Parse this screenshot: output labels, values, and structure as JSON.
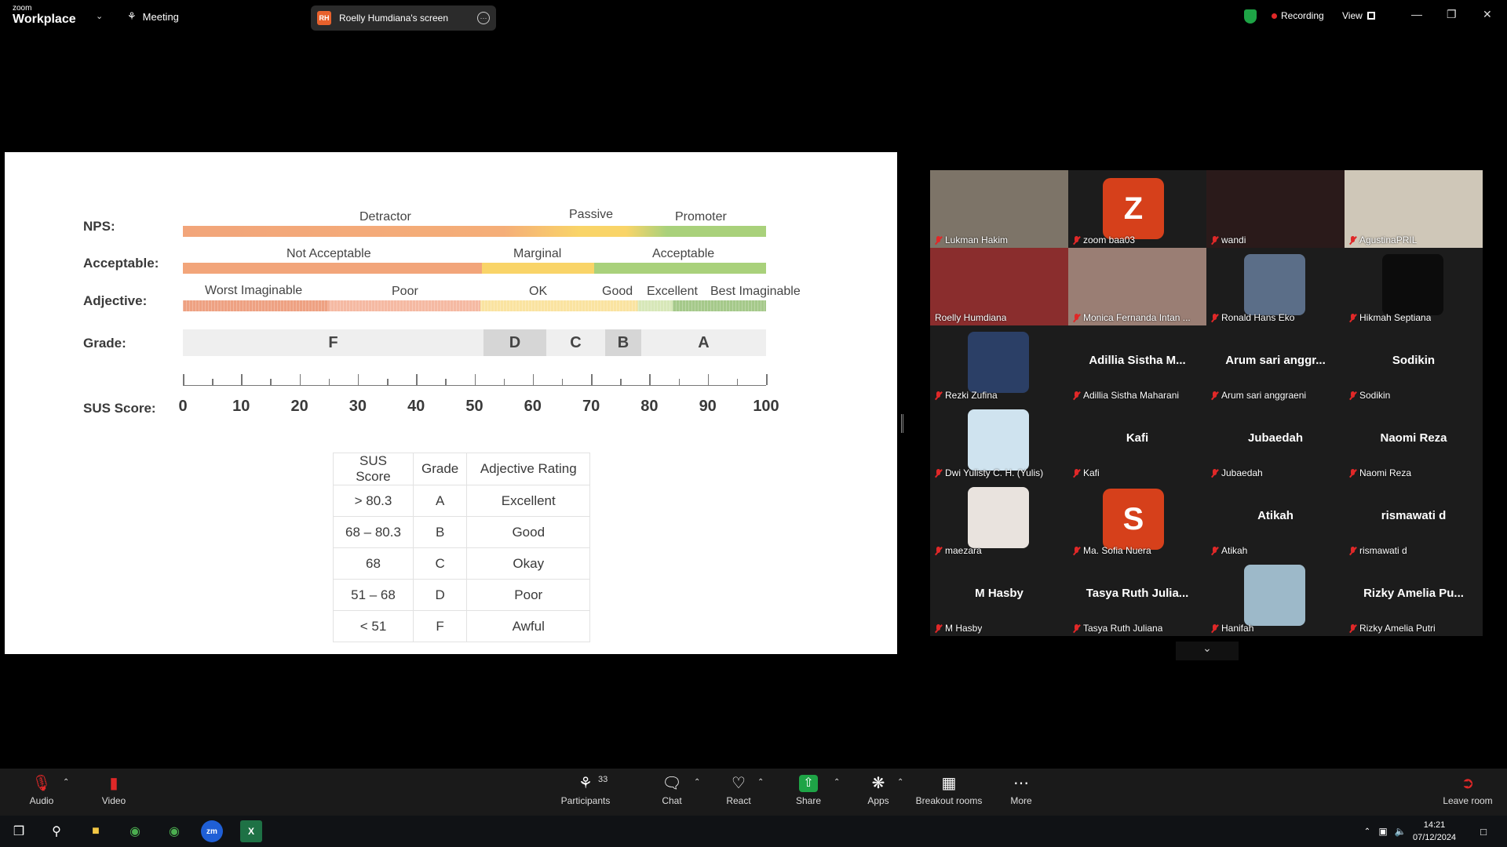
{
  "topbar": {
    "logo_line1": "zoom",
    "logo_line2": "Workplace",
    "meeting_label": "Meeting",
    "screen_share_badge": "RH",
    "screen_share_label": "Roelly Humdiana's screen",
    "recording_label": "Recording",
    "view_label": "View",
    "colors": {
      "recording": "#e02828",
      "shield": "#1ea446"
    }
  },
  "slide": {
    "rows": {
      "nps": "NPS:",
      "acceptable": "Acceptable:",
      "adjective": "Adjective:",
      "grade": "Grade:",
      "sus": "SUS Score:"
    },
    "nps_labels": [
      "Detractor",
      "Passive",
      "Promoter"
    ],
    "acceptable_labels": [
      "Not Acceptable",
      "Marginal",
      "Acceptable"
    ],
    "adjective_labels": [
      "Worst Imaginable",
      "Poor",
      "OK",
      "Good",
      "Excellent",
      "Best Imaginable"
    ],
    "grades": [
      "F",
      "D",
      "C",
      "B",
      "A"
    ],
    "sus_scale": [
      "0",
      "10",
      "20",
      "30",
      "40",
      "50",
      "60",
      "70",
      "80",
      "90",
      "100"
    ],
    "table": {
      "headers": [
        "SUS Score",
        "Grade",
        "Adjective Rating"
      ],
      "rows": [
        [
          "> 80.3",
          "A",
          "Excellent"
        ],
        [
          "68 – 80.3",
          "B",
          "Good"
        ],
        [
          "68",
          "C",
          "Okay"
        ],
        [
          "51 – 68",
          "D",
          "Poor"
        ],
        [
          "< 51",
          "F",
          "Awful"
        ]
      ]
    }
  },
  "gallery": {
    "participants": [
      {
        "name": "Lukman Hakim",
        "muted": true,
        "video": "photo"
      },
      {
        "name": "zoom baa03",
        "muted": true,
        "avatar_letter": "Z"
      },
      {
        "name": "wandi",
        "muted": true,
        "video": "photo"
      },
      {
        "name": "AgustinaPRIL",
        "muted": true,
        "video": "photo"
      },
      {
        "name": "Roelly Humdiana",
        "muted": false,
        "video": "photo",
        "speaking": true
      },
      {
        "name": "Monica Fernanda Intan ...",
        "muted": true,
        "video": "photo"
      },
      {
        "name": "Ronald Hans Eko",
        "muted": true,
        "video": "photo"
      },
      {
        "name": "Hikmah Septiana",
        "muted": true,
        "video": "photo"
      },
      {
        "name": "Rezki Zufina",
        "muted": true,
        "video": "photo"
      },
      {
        "name": "Adillia Sistha Maharani",
        "display": "Adillia Sistha M...",
        "muted": true
      },
      {
        "name": "Arum sari anggraeni",
        "display": "Arum sari anggr...",
        "muted": true
      },
      {
        "name": "Sodikin",
        "display": "Sodikin",
        "muted": true
      },
      {
        "name": "Dwi Yulisty C. H. (Yulis)",
        "muted": true,
        "video": "photo"
      },
      {
        "name": "Kafi",
        "display": "Kafi",
        "muted": true
      },
      {
        "name": "Jubaedah",
        "display": "Jubaedah",
        "muted": true
      },
      {
        "name": "Naomi Reza",
        "display": "Naomi Reza",
        "muted": true
      },
      {
        "name": "maezara",
        "muted": true,
        "video": "photo"
      },
      {
        "name": "Ma. Sofia Nuera",
        "muted": true,
        "avatar_letter": "S"
      },
      {
        "name": "Atikah",
        "display": "Atikah",
        "muted": true
      },
      {
        "name": "rismawati d",
        "display": "rismawati d",
        "muted": true
      },
      {
        "name": "M Hasby",
        "display": "M Hasby",
        "muted": true
      },
      {
        "name": "Tasya Ruth Juliana",
        "display": "Tasya Ruth Julia...",
        "muted": true
      },
      {
        "name": "Hanifah",
        "muted": true,
        "video": "photo"
      },
      {
        "name": "Rizky Amelia Putri",
        "display": "Rizky Amelia Pu...",
        "muted": true
      }
    ]
  },
  "toolbar": {
    "audio": "Audio",
    "video": "Video",
    "participants": "Participants",
    "participants_count": "33",
    "chat": "Chat",
    "react": "React",
    "share": "Share",
    "apps": "Apps",
    "breakout": "Breakout rooms",
    "more": "More",
    "leave": "Leave room"
  },
  "taskbar": {
    "time": "14:21",
    "date": "07/12/2024"
  }
}
